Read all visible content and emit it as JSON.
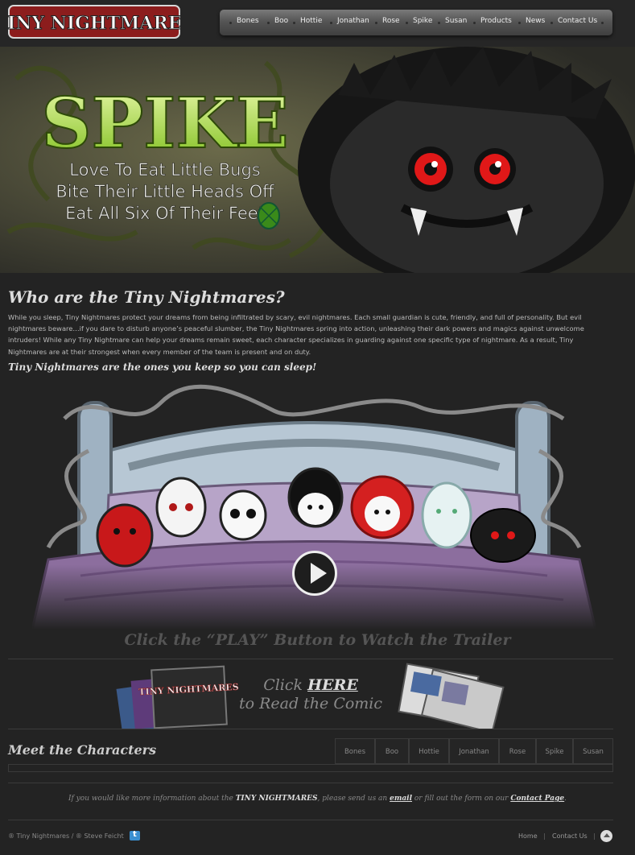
{
  "header": {
    "logo_text": "TINY NIGHTMARES",
    "nav": [
      "Bones",
      "Boo",
      "Hottie",
      "Jonathan",
      "Rose",
      "Spike",
      "Susan",
      "Products",
      "News",
      "Contact Us"
    ]
  },
  "banner": {
    "title": "SPIKE",
    "lines": [
      "Love To Eat Little Bugs",
      "Bite Their Little Heads Off",
      "Eat All Six Of Their Feet"
    ]
  },
  "thumbs": [
    "BONES",
    "BOO",
    "HOTTIE",
    "JONATHAN",
    "ROSE",
    "SPIKE",
    "SUSAN"
  ],
  "intro": {
    "heading": "Who are the Tiny Nightmares?",
    "body": "While you sleep, Tiny Nightmares protect your dreams from being infiltrated by scary, evil nightmares. Each small guardian is cute, friendly, and full of personality. But evil nightmares beware…if you dare to disturb anyone’s peaceful slumber, the Tiny Nightmares spring into action, unleashing their dark powers and magics against unwelcome intruders! While any Tiny Nightmare can help your dreams remain sweet, each character specializes in guarding against one specific type of nightmare. As a result, Tiny Nightmares are at their strongest when every member of the team is present and on duty.",
    "tagline": "Tiny Nightmares are the ones you keep so you can sleep!"
  },
  "video": {
    "cta": "Click the “PLAY” Button to Watch the Trailer"
  },
  "comic": {
    "click": "Click",
    "here": "HERE",
    "rest": "to Read the Comic",
    "cover_title": "TINY NIGHTMARES"
  },
  "characters": {
    "heading": "Meet the Characters",
    "tabs": [
      "Bones",
      "Boo",
      "Hottie",
      "Jonathan",
      "Rose",
      "Spike",
      "Susan"
    ]
  },
  "info": {
    "pre": "If you would like more information about the",
    "brand": "TINY NIGHTMARES",
    "mid": ", please send us an",
    "email": "email",
    "mid2": "or fill out the form on our",
    "contact": "Contact Page",
    "end": "."
  },
  "footer": {
    "copyright": "® Tiny Nightmares / ® Steve Feicht",
    "links": [
      "Home",
      "Contact Us"
    ],
    "separator": "|"
  },
  "colors": {
    "background": "#232323",
    "nav": "#555555",
    "accent_green": "#a4d63a",
    "spike_eye": "#e01818"
  }
}
